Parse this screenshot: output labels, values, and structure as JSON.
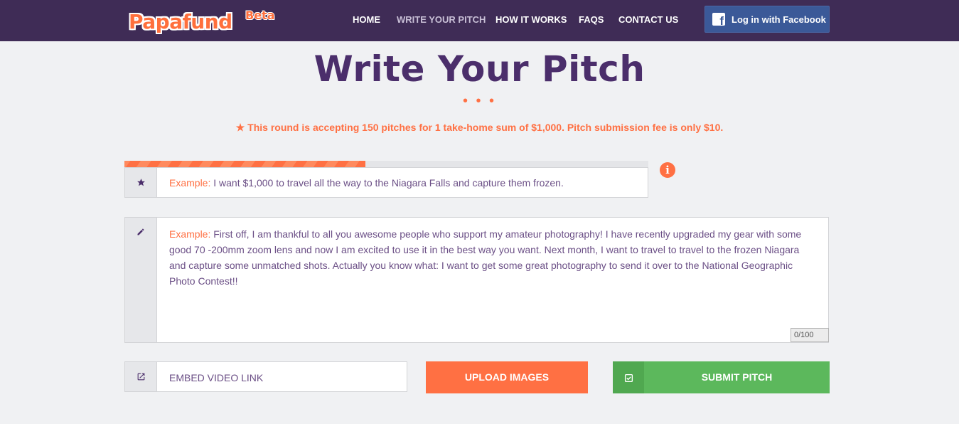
{
  "brand": {
    "name": "Papafund",
    "badge": "Beta"
  },
  "nav": {
    "items": [
      {
        "label": "HOME",
        "active": false
      },
      {
        "label": "WRITE YOUR PITCH",
        "active": true
      },
      {
        "label": "HOW IT WORKS",
        "active": false
      },
      {
        "label": "FAQS",
        "active": false
      },
      {
        "label": "CONTACT US",
        "active": false
      }
    ],
    "facebook_label": "Log in with Facebook",
    "facebook_icon": "f"
  },
  "page": {
    "title": "Write Your Pitch",
    "dots": "• • •",
    "notice": "★ This round is accepting 150 pitches for 1 take-home sum of $1,000. Pitch submission fee is only $10.",
    "progress_percent": 46
  },
  "form": {
    "info_icon": "i",
    "title_field": {
      "icon": "star-icon",
      "example_label": "Example:",
      "placeholder": " I want $1,000 to travel all the way to the Niagara Falls and capture them frozen."
    },
    "description_field": {
      "icon": "pencil-icon",
      "example_label": "Example:",
      "placeholder": " First off, I am thankful to all you awesome people who support my amateur photography! I have recently upgraded my gear with some good 70 -200mm zoom lens and now I am excited to use it in the best way you want. Next month, I want to travel to travel to the frozen Niagara and capture some unmatched shots. Actually you know what: I want to get some great photography to send it over to the National Geographic Photo Contest!!",
      "counter": "0/100"
    },
    "video_field": {
      "icon": "external-link-icon",
      "placeholder": "EMBED VIDEO LINK"
    },
    "upload_label": "UPLOAD IMAGES",
    "submit_label": "SUBMIT PITCH",
    "submit_icon": "check-square-icon"
  },
  "colors": {
    "navbar": "#3f2c56",
    "accent": "#ff7043",
    "title": "#4b2e6b",
    "facebook": "#3b5998",
    "submit": "#5cb85c"
  }
}
